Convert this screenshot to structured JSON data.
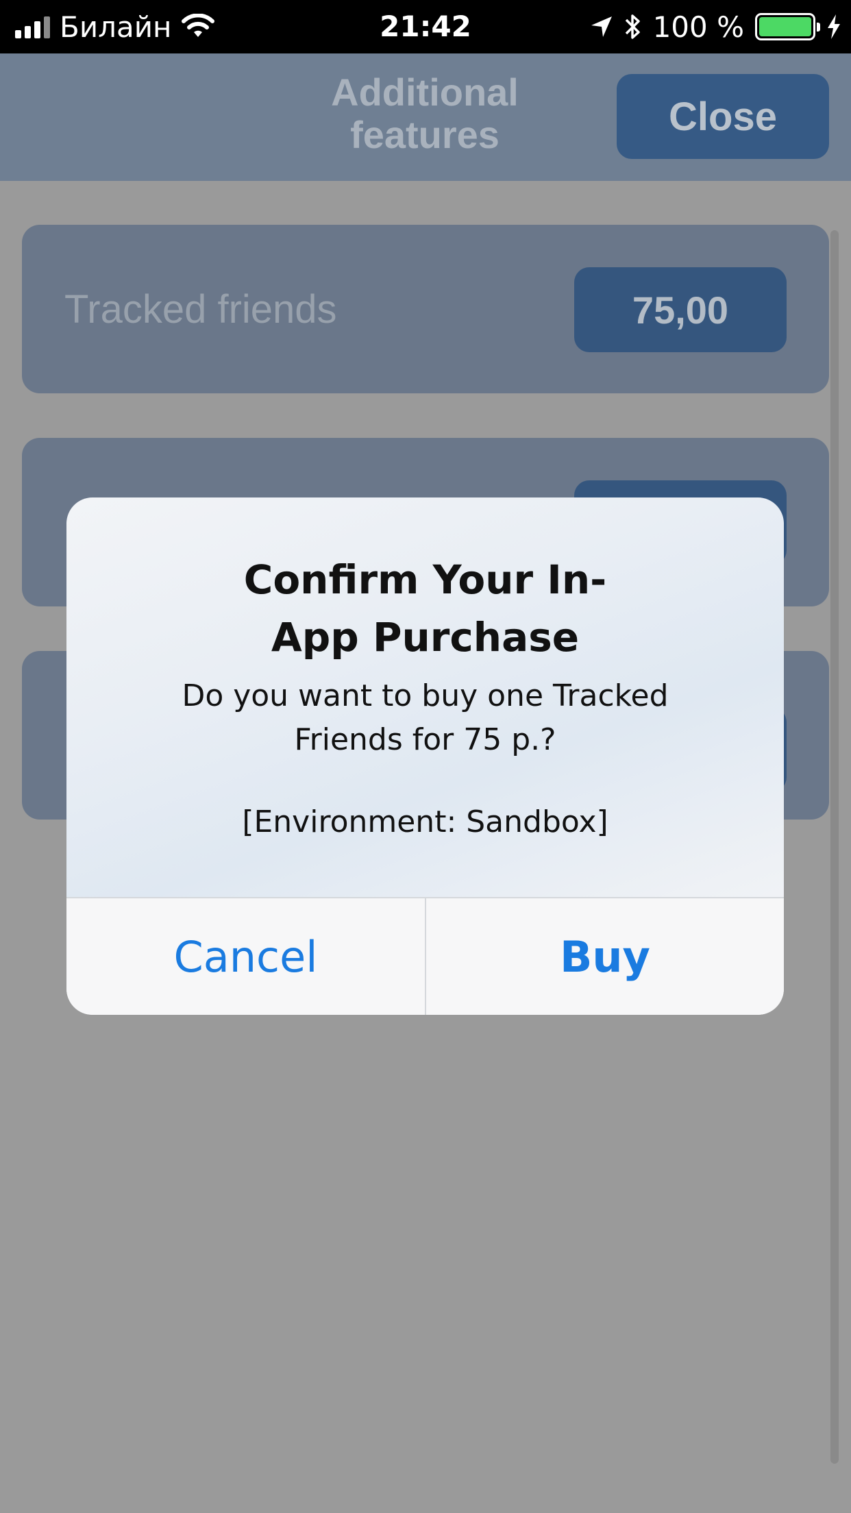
{
  "status_bar": {
    "carrier": "Билайн",
    "time": "21:42",
    "battery": "100 %",
    "battery_level": 1.0,
    "icons": [
      "signal-icon",
      "wifi-icon",
      "location-arrow-icon",
      "bluetooth-icon",
      "battery-icon",
      "charging-bolt-icon"
    ]
  },
  "header": {
    "title_line1": "Additional",
    "title_line2": "features",
    "close_label": "Close"
  },
  "features": [
    {
      "label": "Tracked friends",
      "price": "75,00"
    }
  ],
  "alert": {
    "title_line1": "Confirm Your In-",
    "title_line2": "App Purchase",
    "message_line1": "Do you want to buy one Tracked",
    "message_line2": "Friends for 75 р.?",
    "environment": "[Environment: Sandbox]",
    "cancel_label": "Cancel",
    "buy_label": "Buy"
  },
  "colors": {
    "accent_blue": "#1a7be0",
    "header_bg": "#6f7f93",
    "button_bg": "#365a85",
    "battery_green": "#4cd964"
  }
}
